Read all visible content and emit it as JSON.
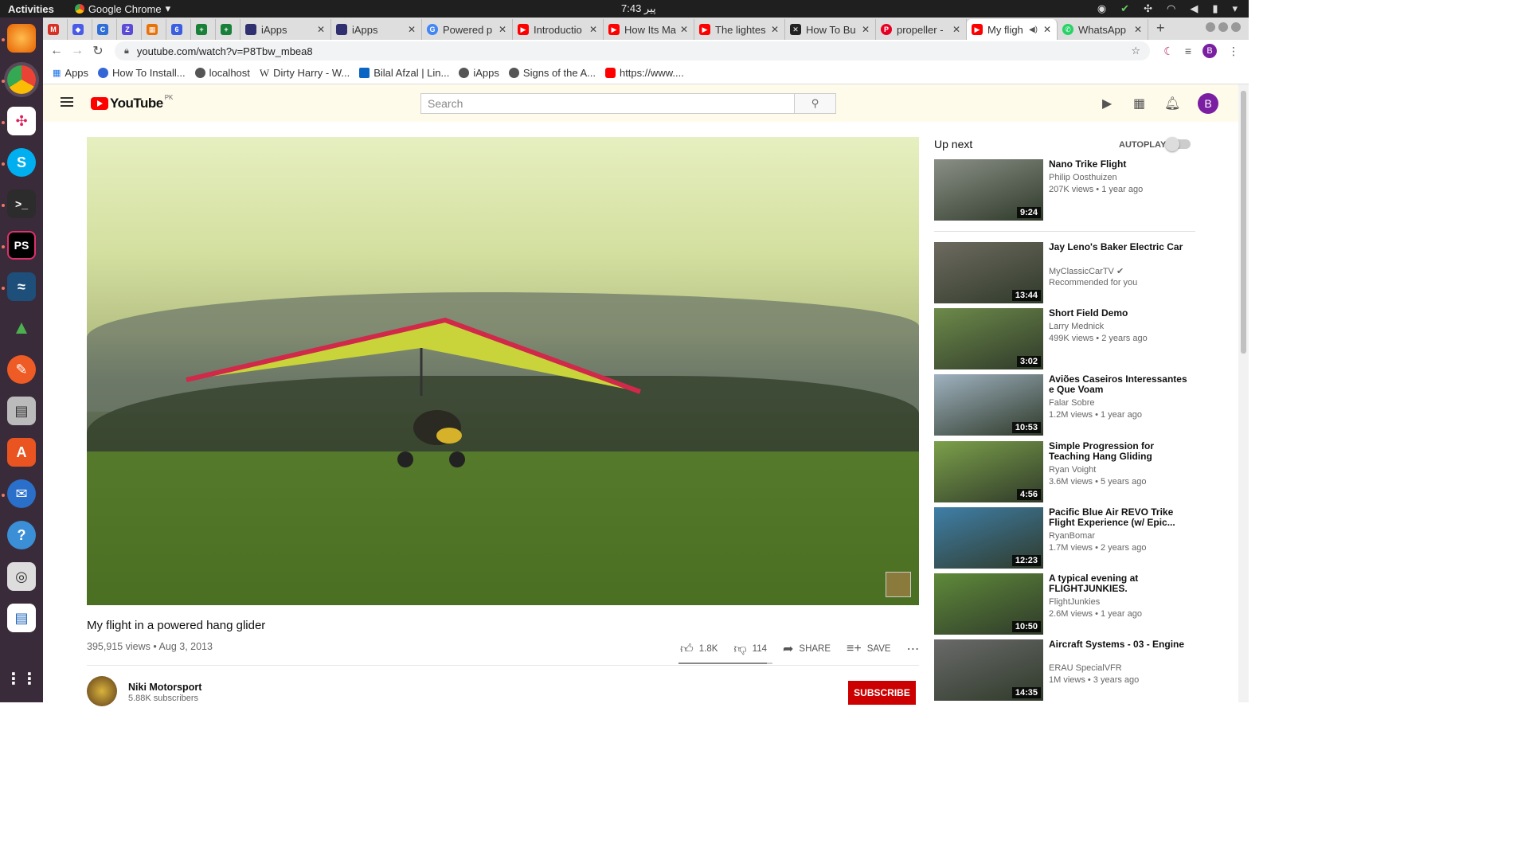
{
  "system": {
    "activities": "Activities",
    "app_name": "Google Chrome",
    "clock": "7:43 پیر"
  },
  "tabs": [
    {
      "title": "",
      "color": "#d93025"
    },
    {
      "title": "",
      "color": "#4a5be8"
    },
    {
      "title": "",
      "color": "#2e6ed6"
    },
    {
      "title": "",
      "color": "#5b4bd6"
    },
    {
      "title": "",
      "color": "#e8710a"
    },
    {
      "title": "",
      "color": "#3a5ee0"
    },
    {
      "title": "",
      "color": "#188038"
    },
    {
      "title": "",
      "color": "#188038"
    },
    {
      "title": "iApps",
      "color": "#303070"
    },
    {
      "title": "iApps",
      "color": "#303070"
    },
    {
      "title": "Powered p",
      "color": "#4285f4"
    },
    {
      "title": "Introductio",
      "color": "#ff0000"
    },
    {
      "title": "How Its Ma",
      "color": "#ff0000"
    },
    {
      "title": "The lightes",
      "color": "#ff0000"
    },
    {
      "title": "How To Bu",
      "color": "#222222"
    },
    {
      "title": "propeller -",
      "color": "#e60023"
    },
    {
      "title": "My fligh",
      "color": "#ff0000"
    },
    {
      "title": "WhatsApp",
      "color": "#25d366"
    }
  ],
  "address_bar": {
    "url": "youtube.com/watch?v=P8Tbw_mbea8"
  },
  "bookmarks": [
    {
      "label": "Apps"
    },
    {
      "label": "How To Install..."
    },
    {
      "label": "localhost"
    },
    {
      "label": "Dirty Harry - W..."
    },
    {
      "label": "Bilal Afzal | Lin..."
    },
    {
      "label": "iApps"
    },
    {
      "label": "Signs of the A..."
    },
    {
      "label": "https://www...."
    }
  ],
  "youtube": {
    "logo_text": "YouTube",
    "country": "PK",
    "search_placeholder": "Search",
    "avatar_letter": "B",
    "video": {
      "title": "My flight in a powered hang glider",
      "meta": "395,915 views • Aug 3, 2013",
      "likes": "1.8K",
      "dislikes": "114",
      "share": "SHARE",
      "save": "SAVE"
    },
    "channel": {
      "name": "Niki Motorsport",
      "subscribers": "5.88K subscribers",
      "subscribe": "SUBSCRIBE"
    },
    "sidebar": {
      "up_next": "Up next",
      "autoplay": "AUTOPLAY",
      "videos": [
        {
          "title": "Nano Trike Flight",
          "channel": "Philip Oosthuizen",
          "stats": "207K views • 1 year ago",
          "duration": "9:24",
          "tone": "#8a8f86"
        },
        {
          "title": "Jay Leno's Baker Electric Car",
          "channel": "MyClassicCarTV ✔",
          "stats": "Recommended for you",
          "duration": "13:44",
          "tone": "#6e6a60"
        },
        {
          "title": "Short Field Demo",
          "channel": "Larry Mednick",
          "stats": "499K views • 2 years ago",
          "duration": "3:02",
          "tone": "#6d8a4a"
        },
        {
          "title": "Aviões Caseiros Interessantes e Que Voam",
          "channel": "Falar Sobre",
          "stats": "1.2M views • 1 year ago",
          "duration": "10:53",
          "tone": "#9fb2c0"
        },
        {
          "title": "Simple Progression for Teaching Hang Gliding",
          "channel": "Ryan Voight",
          "stats": "3.6M views • 5 years ago",
          "duration": "4:56",
          "tone": "#7ca04a"
        },
        {
          "title": "Pacific Blue Air REVO Trike Flight Experience (w/ Epic...",
          "channel": "RyanBomar",
          "stats": "1.7M views • 2 years ago",
          "duration": "12:23",
          "tone": "#3f7fa8"
        },
        {
          "title": "A typical evening at FLIGHTJUNKIES.",
          "channel": "FlightJunkies",
          "stats": "2.6M views • 1 year ago",
          "duration": "10:50",
          "tone": "#5f8a3a"
        },
        {
          "title": "Aircraft Systems - 03 - Engine",
          "channel": "ERAU SpecialVFR",
          "stats": "1M views • 3 years ago",
          "duration": "14:35",
          "tone": "#6a6a6a"
        }
      ]
    }
  }
}
